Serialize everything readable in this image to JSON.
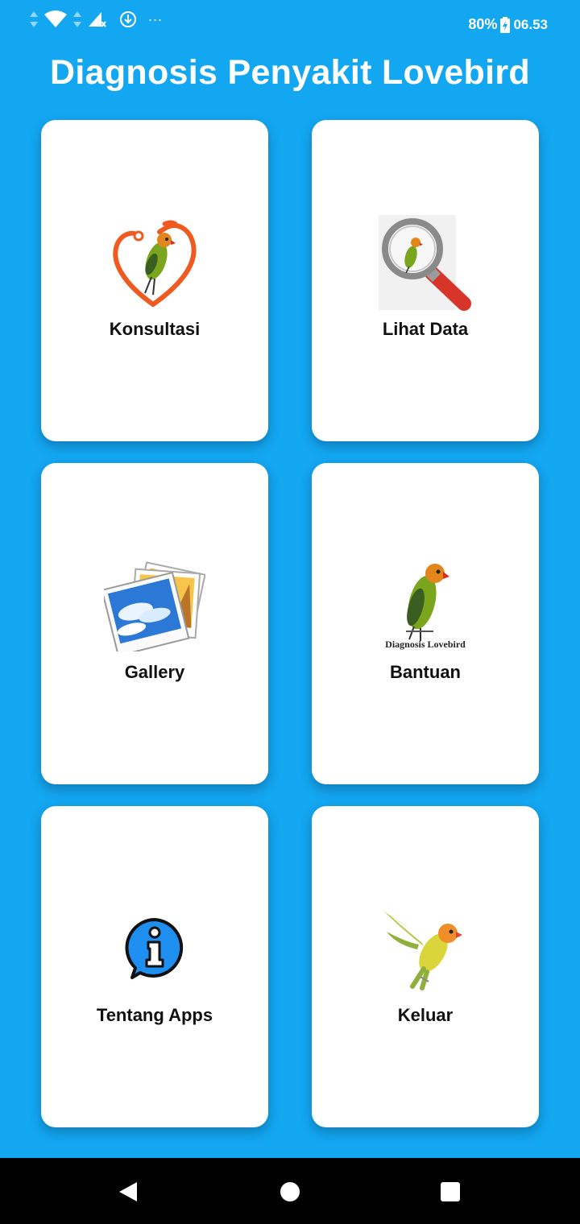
{
  "status_bar": {
    "battery": "80%",
    "time": "06.53",
    "overflow": "..."
  },
  "header": {
    "title": "Diagnosis Penyakit Lovebird"
  },
  "menu": [
    {
      "label": "Konsultasi",
      "icon": "stethoscope-heart-lovebird-icon"
    },
    {
      "label": "Lihat Data",
      "icon": "magnifier-lovebird-icon"
    },
    {
      "label": "Gallery",
      "icon": "photo-gallery-icon"
    },
    {
      "label": "Bantuan",
      "icon": "lovebird-logo-icon",
      "icon_caption": "Diagnosis Lovebird"
    },
    {
      "label": "Tentang Apps",
      "icon": "info-bubble-icon"
    },
    {
      "label": "Keluar",
      "icon": "flying-lovebird-icon"
    }
  ],
  "colors": {
    "background": "#13a6f1",
    "card": "#ffffff",
    "navigation_bar": "#000000"
  }
}
